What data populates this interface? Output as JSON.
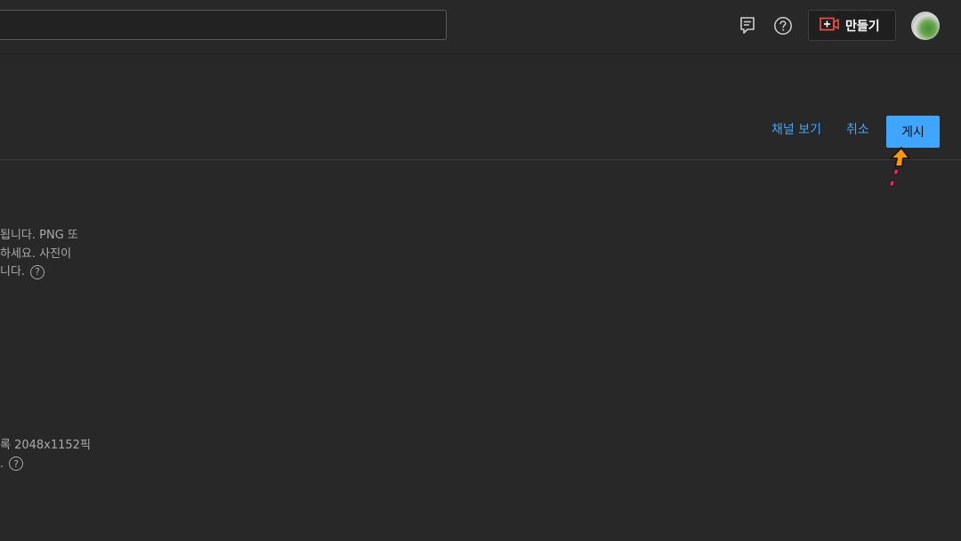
{
  "topbar": {
    "search_placeholder": "",
    "create_label": "만들기",
    "icons": {
      "feedback": "feedback-icon",
      "help": "help-icon",
      "create": "video-create-icon"
    }
  },
  "actions": {
    "view_channel": "채널 보기",
    "cancel": "취소",
    "publish": "게시"
  },
  "section1": {
    "line1": "됩니다. PNG 또",
    "line2": "하세요. 사진이",
    "line3": "니다."
  },
  "section2": {
    "line1": "록 2048x1152픽",
    "line2": "."
  },
  "help_glyph": "?",
  "colors": {
    "accent": "#3ea6ff",
    "background": "#282828",
    "cursor": "#ff9800"
  }
}
